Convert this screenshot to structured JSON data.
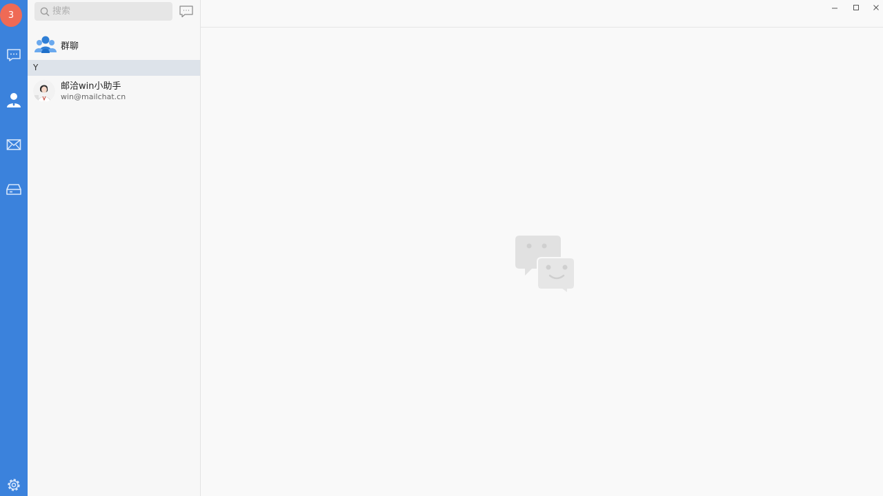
{
  "app": {
    "accent": "#3b82dc",
    "badge_color": "#ef6a55"
  },
  "user": {
    "avatar_text": "3"
  },
  "nav": [
    {
      "name": "chat",
      "icon": "chat-bubble-icon"
    },
    {
      "name": "contacts",
      "icon": "person-icon"
    },
    {
      "name": "mail",
      "icon": "envelope-icon"
    },
    {
      "name": "drive",
      "icon": "drive-icon"
    },
    {
      "name": "settings",
      "icon": "gear-icon"
    }
  ],
  "search": {
    "placeholder": "搜索",
    "value": ""
  },
  "group": {
    "label": "群聊"
  },
  "section": {
    "letter": "Y"
  },
  "contacts": [
    {
      "name": "邮洽win小助手",
      "email": "win@mailchat.cn"
    }
  ]
}
